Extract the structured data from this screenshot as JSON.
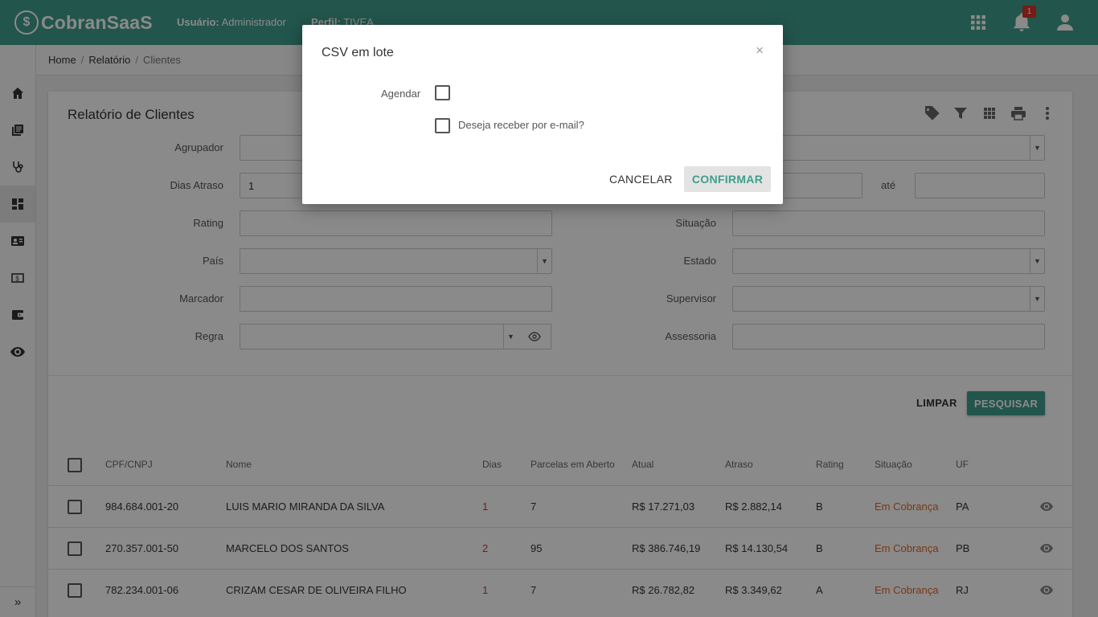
{
  "app": {
    "logo_text": "CobranSaaS",
    "user_label": "Usuário:",
    "user_value": "Administrador",
    "perfil_label": "Perfil:",
    "perfil_value": "TIVEA",
    "notification_count": "1"
  },
  "icons": {
    "apps": "apps-grid-icon",
    "bell": "bell-icon",
    "user": "user-icon",
    "sidebar": [
      "home-icon",
      "library-books-icon",
      "stethoscope-icon",
      "dashboard-icon",
      "contact-card-icon",
      "money-icon",
      "wallet-icon",
      "eye-icon"
    ],
    "tools": [
      "tag-icon",
      "filter-icon",
      "grid-icon",
      "print-icon",
      "more-vert-icon"
    ]
  },
  "breadcrumb": {
    "items": [
      "Home",
      "Relatório",
      "Clientes"
    ]
  },
  "card": {
    "title": "Relatório de Clientes"
  },
  "filters": {
    "agrupador_label": "Agrupador",
    "dias_atraso_label": "Dias Atraso",
    "dias_atraso_value": "1",
    "ate_label": "até",
    "rating_label": "Rating",
    "situacao_label": "Situação",
    "pais_label": "País",
    "estado_label": "Estado",
    "marcador_label": "Marcador",
    "supervisor_label": "Supervisor",
    "regra_label": "Regra",
    "assessoria_label": "Assessoria"
  },
  "actions": {
    "limpar": "LIMPAR",
    "pesquisar": "PESQUISAR"
  },
  "table": {
    "headers": [
      "CPF/CNPJ",
      "Nome",
      "Dias",
      "Parcelas em Aberto",
      "Atual",
      "Atraso",
      "Rating",
      "Situação",
      "UF"
    ],
    "rows": [
      {
        "cpf": "984.684.001-20",
        "nome": "LUIS MARIO MIRANDA DA SILVA",
        "dias": "1",
        "parcelas": "7",
        "atual": "R$ 17.271,03",
        "atraso": "R$ 2.882,14",
        "rating": "B",
        "situacao": "Em Cobrança",
        "uf": "PA"
      },
      {
        "cpf": "270.357.001-50",
        "nome": "MARCELO DOS SANTOS",
        "dias": "2",
        "parcelas": "95",
        "atual": "R$ 386.746,19",
        "atraso": "R$ 14.130,54",
        "rating": "B",
        "situacao": "Em Cobrança",
        "uf": "PB"
      },
      {
        "cpf": "782.234.001-06",
        "nome": "CRIZAM CESAR DE OLIVEIRA FILHO",
        "dias": "1",
        "parcelas": "7",
        "atual": "R$ 26.782,82",
        "atraso": "R$ 3.349,62",
        "rating": "A",
        "situacao": "Em Cobrança",
        "uf": "RJ"
      }
    ]
  },
  "modal": {
    "title": "CSV em lote",
    "close": "×",
    "agendar_label": "Agendar",
    "email_label": "Deseja receber por e-mail?",
    "cancel": "CANCELAR",
    "confirm": "CONFIRMAR"
  },
  "colors": {
    "primary": "#3f9e8c",
    "danger": "#d9342b",
    "status": "#e0672a"
  }
}
